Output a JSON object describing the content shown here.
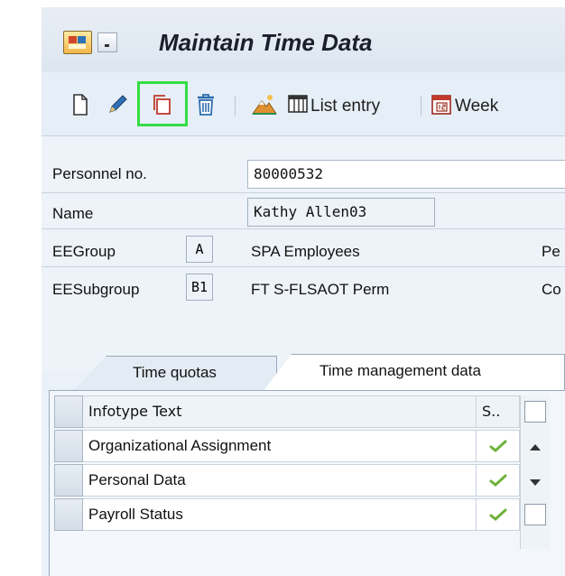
{
  "window": {
    "title": "Maintain Time Data"
  },
  "toolbar": {
    "list_entry_label": "List entry",
    "week_label": "Week"
  },
  "form": {
    "personnel_no": {
      "label": "Personnel no.",
      "value": "80000532"
    },
    "name": {
      "label": "Name",
      "value": "Kathy Allen03"
    },
    "ee_group": {
      "label": "EEGroup",
      "code": "A",
      "text": "SPA Employees",
      "trailing": "Pe"
    },
    "ee_subgroup": {
      "label": "EESubgroup",
      "code": "B1",
      "text": "FT S-FLSAOT Perm",
      "trailing": "Co"
    }
  },
  "tabs": [
    {
      "label": "Time quotas",
      "active": false
    },
    {
      "label": "Time management data",
      "active": true
    }
  ],
  "table": {
    "headers": {
      "infotype_text": "Infotype Text",
      "status": "S.."
    },
    "rows": [
      {
        "text": "Organizational Assignment",
        "status": "check"
      },
      {
        "text": "Personal Data",
        "status": "check"
      },
      {
        "text": "Payroll Status",
        "status": "check"
      }
    ]
  },
  "colors": {
    "highlight": "#33dd44",
    "check": "#6fb23a"
  }
}
